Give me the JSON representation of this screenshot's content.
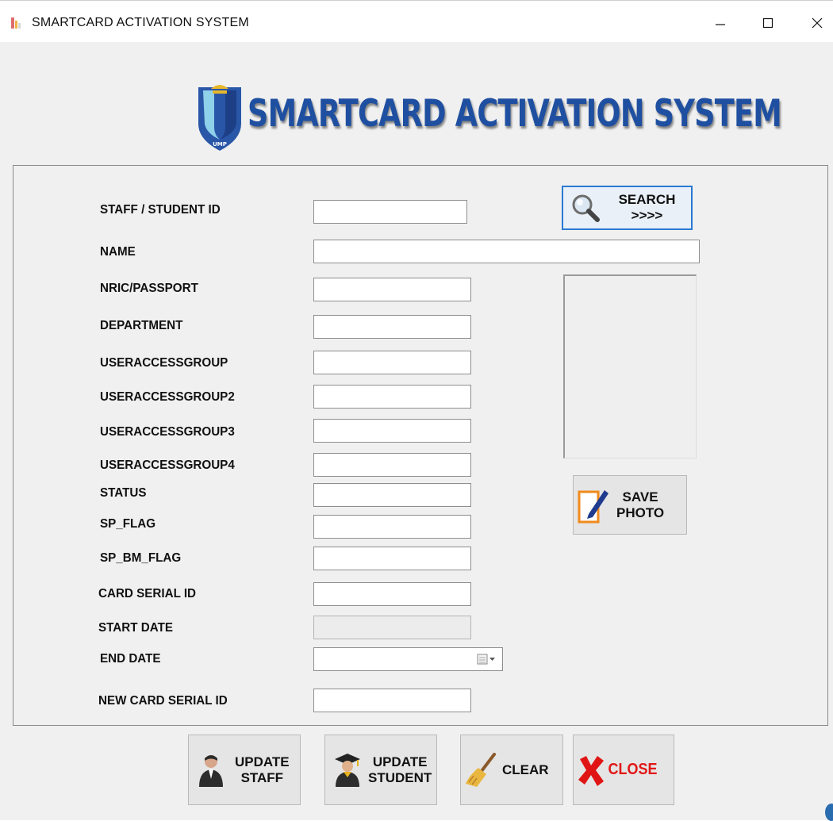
{
  "window": {
    "title": "SMARTCARD ACTIVATION SYSTEM"
  },
  "banner": {
    "title": "SMARTCARD ACTIVATION SYSTEM",
    "logo_text": "UMP"
  },
  "form": {
    "labels": {
      "staff_student_id": "STAFF / STUDENT ID",
      "name": "NAME",
      "nric_passport": "NRIC/PASSPORT",
      "department": "DEPARTMENT",
      "useraccessgroup": "USERACCESSGROUP",
      "useraccessgroup2": "USERACCESSGROUP2",
      "useraccessgroup3": "USERACCESSGROUP3",
      "useraccessgroup4": "USERACCESSGROUP4",
      "status": "STATUS",
      "sp_flag": "SP_FLAG",
      "sp_bm_flag": "SP_BM_FLAG",
      "card_serial_id": "CARD SERIAL ID",
      "start_date": "START DATE",
      "end_date": "END DATE",
      "new_card_serial_id": "NEW CARD SERIAL ID"
    },
    "values": {
      "staff_student_id": "",
      "name": "",
      "nric_passport": "",
      "department": "",
      "useraccessgroup": "",
      "useraccessgroup2": "",
      "useraccessgroup3": "",
      "useraccessgroup4": "",
      "status": "",
      "sp_flag": "",
      "sp_bm_flag": "",
      "card_serial_id": "",
      "start_date": "",
      "end_date": "",
      "new_card_serial_id": ""
    }
  },
  "buttons": {
    "search": "SEARCH >>>>",
    "save_photo_line1": "SAVE",
    "save_photo_line2": "PHOTO",
    "update_staff_line1": "UPDATE",
    "update_staff_line2": "STAFF",
    "update_student_line1": "UPDATE",
    "update_student_line2": "STUDENT",
    "clear": "CLEAR",
    "close": "CLOSE"
  },
  "icons": {
    "app": "app-icon",
    "minimize": "minimize-icon",
    "maximize": "maximize-icon",
    "close": "close-icon",
    "search": "magnifier-icon",
    "save_photo": "pen-paper-icon",
    "update_staff": "staff-person-icon",
    "update_student": "graduate-icon",
    "clear": "broom-icon",
    "close_button": "red-x-icon",
    "calendar": "calendar-icon"
  },
  "colors": {
    "banner_blue": "#1f4fa0",
    "focus_border": "#2a7ad2",
    "close_red": "#e11818",
    "window_bg": "#f0f0f0"
  }
}
